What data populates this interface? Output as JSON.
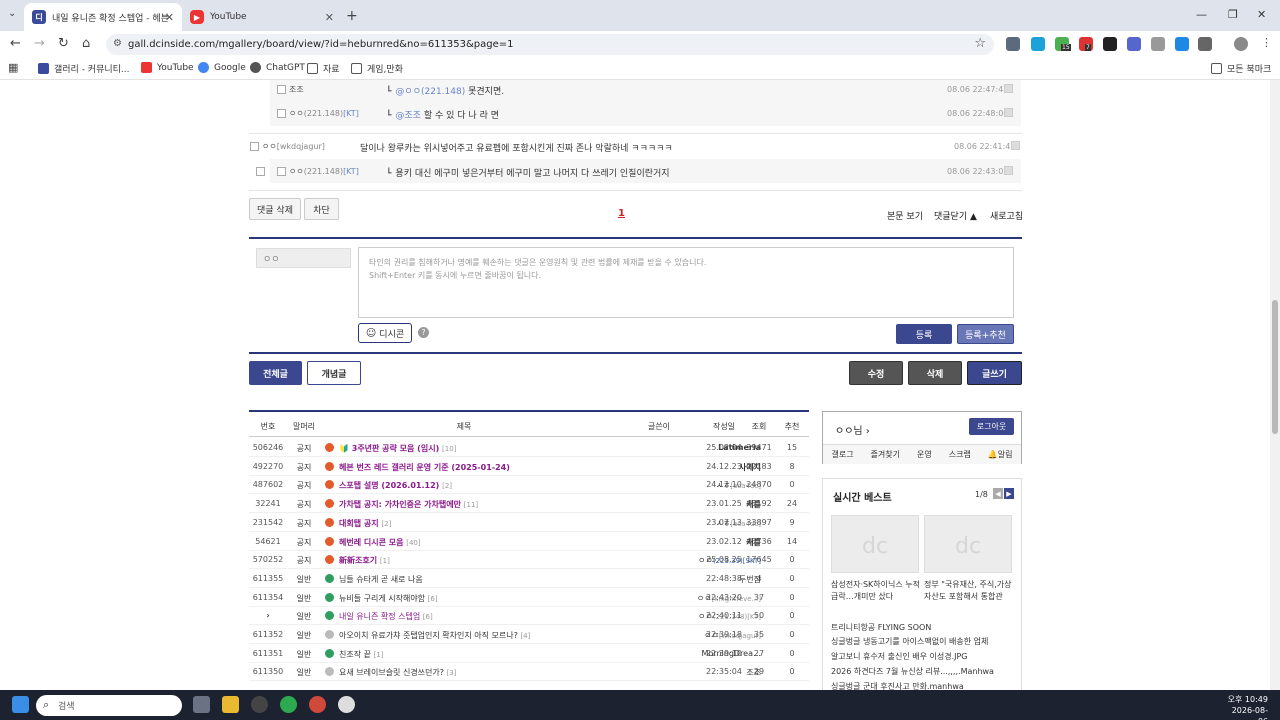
{
  "browser": {
    "tabs": [
      {
        "title": "내일 유니즌 확정 스텝업 - 헤븐",
        "active": true
      },
      {
        "title": "YouTube",
        "active": false
      }
    ],
    "url": "gall.dcinside.com/mgallery/board/view/?id=heburnred&no=611353&page=1",
    "bookmarks": [
      "갤러리 - 커뮤니티...",
      "YouTube",
      "Google",
      "ChatGPT",
      "자료",
      "게임,만화"
    ],
    "all_bookmarks": "모든 북마크",
    "ext_badges": [
      "15",
      "7"
    ]
  },
  "comments": [
    {
      "nick": "조조",
      "ip": "",
      "reply": true,
      "mention": "@ㅇㅇ(221.148)",
      "text": "못견지면.",
      "time": "08.06 22:47:47"
    },
    {
      "nick": "ㅇㅇ",
      "ip": "(221.148)",
      "ipsuffix": "[KT]",
      "reply": true,
      "mention": "@조조",
      "text": "할 수 있 다 나 라 면",
      "time": "08.06 22:48:06"
    },
    {
      "nick": "ㅇㅇ",
      "ip": "",
      "ipsuffix": "[wkdqjagur]",
      "reply": false,
      "mention": "",
      "text": "달이나 왕루카는 위시넣어주고 유료펩에 포함시킨게 진짜 존나 악랄하네 ㅋㅋㅋㅋㅋ",
      "time": "08.06 22:41:42"
    },
    {
      "nick": "ㅇㅇ",
      "ip": "(221.148)",
      "ipsuffix": "[KT]",
      "reply": true,
      "mention": "",
      "text": "용키 대신 에구미 넣은거부터 에구미 말고 나머지 다 쓰레기 인질이란거지",
      "time": "08.06 22:43:03"
    }
  ],
  "comment_actions": {
    "delete": "댓글 삭제",
    "block": "차단",
    "page": "1",
    "view_post": "본문 보기",
    "collapse": "댓글닫기 ▲",
    "refresh": "새로고침"
  },
  "write": {
    "nick_placeholder": "ㅇㅇ",
    "textarea_line1": "타인의 권리를 침해하거나 명예를 훼손하는 댓글은 운영원칙 및 관련 법률에 제재를 받을 수 있습니다.",
    "textarea_line2": "Shift+Enter 키를 동시에 누르면 줄바꿈이 됩니다.",
    "dccon": "디시콘",
    "help": "?",
    "submit": "등록",
    "submit_recommend": "등록+추천"
  },
  "list_nav": {
    "all": "전체글",
    "concept": "개념글",
    "edit": "수정",
    "delete": "삭제",
    "write": "글쓰기"
  },
  "table": {
    "headers": [
      "번호",
      "말머리",
      "제목",
      "글쓴이",
      "작성일",
      "조회",
      "추천"
    ],
    "rows": [
      {
        "num": "506246",
        "head": "공지",
        "icon": "red",
        "title": "🔰 3주년판 공략 모음 (임시)",
        "cc": "[10]",
        "writer": "Latimeria",
        "ip": "",
        "date": "25.02.04",
        "views": "39471",
        "recom": "15",
        "notice": true
      },
      {
        "num": "492270",
        "head": "공지",
        "icon": "red",
        "title": "헤븐 번즈 레드 갤러리 운영 기준 (2025-01-24)",
        "cc": "",
        "writer": "사에치",
        "ip": "",
        "date": "24.12.23",
        "views": "22183",
        "recom": "8",
        "notice": true
      },
      {
        "num": "487602",
        "head": "공지",
        "icon": "red",
        "title": "스포탭 설명 (2026.01.12)",
        "cc": "[2]",
        "writer": "ㅅㅎ",
        "ip": "[aca4dc]",
        "date": "24.12.10",
        "views": "24870",
        "recom": "0",
        "notice": true
      },
      {
        "num": "32241",
        "head": "공지",
        "icon": "red",
        "title": "가차탭 공지: 가차인증은 가차탭에만",
        "cc": "[11]",
        "writer": "캐틀",
        "ip": "",
        "date": "23.01.25",
        "views": "48192",
        "recom": "24",
        "notice": true
      },
      {
        "num": "231542",
        "head": "공지",
        "icon": "red",
        "title": "대회탭 공지",
        "cc": "[2]",
        "writer": "ㅅㅎ",
        "ip": "[aca4dc]",
        "date": "23.07.13",
        "views": "33897",
        "recom": "9",
        "notice": true
      },
      {
        "num": "54621",
        "head": "공지",
        "icon": "red",
        "title": "헤번레 디시콘 모음",
        "cc": "[40]",
        "writer": "캐틀",
        "ip": "",
        "date": "23.02.12",
        "views": "45736",
        "recom": "14",
        "notice": true
      },
      {
        "num": "570252",
        "head": "공지",
        "icon": "red",
        "title": "新新조호기",
        "cc": "[1]",
        "writer": "ㅇㅇ",
        "ip": "(223.39)[SKT]",
        "date": "25.08.25",
        "views": "17645",
        "recom": "0",
        "notice": true
      },
      {
        "num": "611355",
        "head": "일반",
        "icon": "green",
        "title": "님들 슈타게 곧 새로 나옴",
        "cc": "",
        "writer": "두번잠",
        "ip": "",
        "date": "22:48:38",
        "views": "4",
        "recom": "0",
        "notice": false
      },
      {
        "num": "611354",
        "head": "일반",
        "icon": "green",
        "title": "뉴비들 구리게 시작해야함",
        "cc": "[6]",
        "writer": "ㅇㅇ",
        "ip": "[knightfeve...]",
        "date": "22:43:20",
        "views": "37",
        "recom": "0",
        "notice": false
      },
      {
        "num": "›",
        "head": "일반",
        "icon": "green",
        "title": "내일 유니즌 확정 스텝업",
        "cc": "[6]",
        "writer": "ㅇㅇ",
        "ip": "(221.148)[KT]",
        "date": "22:40:11",
        "views": "50",
        "recom": "0",
        "notice": false,
        "current": true
      },
      {
        "num": "611352",
        "head": "일반",
        "icon": "grey",
        "title": "아오이치 유료가챠 줏탭업인지 확차인지 아직 모르나?",
        "cc": "[4]",
        "writer": "ㅇㅇ",
        "ip": "[wkdqjagur]",
        "date": "22:39:18",
        "views": "35",
        "recom": "0",
        "notice": false
      },
      {
        "num": "611351",
        "head": "일반",
        "icon": "green",
        "title": "친조작 끝",
        "cc": "[1]",
        "writer": "MorningDrea…",
        "ip": "",
        "date": "22:39:10",
        "views": "27",
        "recom": "0",
        "notice": false
      },
      {
        "num": "611350",
        "head": "일반",
        "icon": "grey",
        "title": "요새 브레이브슬릿 신경쓰던가?",
        "cc": "[3]",
        "writer": "조조",
        "ip": "",
        "date": "22:35:04",
        "views": "29",
        "recom": "0",
        "notice": false
      }
    ]
  },
  "sidebar": {
    "user": "ㅇㅇ님",
    "logout": "로그아웃",
    "links": [
      "갤로그",
      "즐겨찾기",
      "운영",
      "스크랩",
      "알림"
    ],
    "best_title": "실시간 베스트",
    "best_page": "1/8",
    "best_captions": [
      "삼성전자·SK하이닉스 누적 급락…개미만 샀다",
      "정부 \"국유재산, 주식,가상자산도 포함해서 통합관"
    ],
    "best_list": [
      "트리니티항공 FLYING SOON",
      "싱글벙글 냉동고기를 아이스팩없이 배송한 업체",
      "알고보니 휴수저 출신인 배우 이성경.JPG",
      "2026 하견다즈 7월 뉴신상 리뷰...,,,,.Manhwa",
      "싱글벙글 군대 후진사고 만화.manhwa"
    ]
  },
  "taskbar": {
    "search": "검색",
    "time": "오후 10:49",
    "date": "2026-08-06"
  },
  "colors": {
    "accent": "#29367c",
    "notice_title": "#8b1a8b"
  }
}
